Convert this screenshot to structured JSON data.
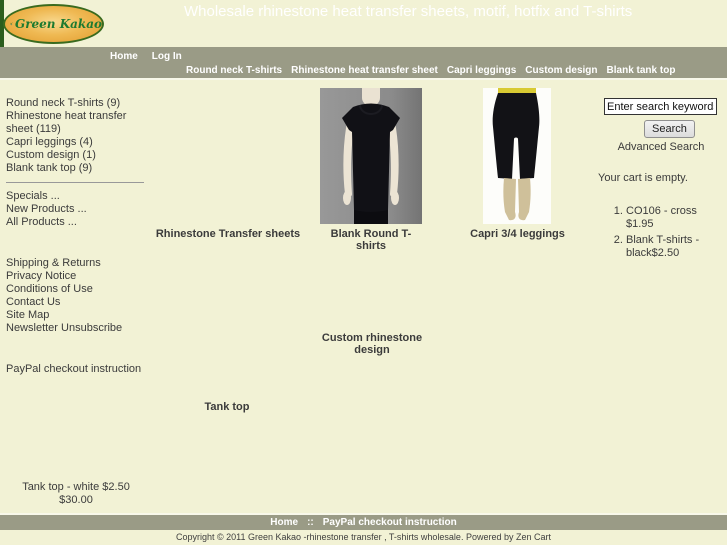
{
  "colors": {
    "page_bg": "#f2f2d5",
    "bar_bg": "#9a9b86",
    "bar_text": "#ffffff",
    "body_text": "#3b3b3b",
    "logo_orange": "#efb953",
    "logo_green": "#1d7a30"
  },
  "header": {
    "logo_text": "Green Kakao",
    "title": "Wholesale rhinestone heat transfer sheets, motif, hotfix and T-shirts"
  },
  "nav": {
    "top_links": [
      "Home",
      "Log In"
    ],
    "category_links": [
      "Round neck T-shirts",
      "Rhinestone heat transfer sheet",
      "Capri leggings",
      "Custom design",
      "Blank tank top"
    ]
  },
  "sidebar": {
    "categories": [
      "Round neck T-shirts (9)",
      "Rhinestone heat transfer sheet (119)",
      "Capri leggings (4)",
      "Custom design (1)",
      "Blank tank top (9)"
    ],
    "browse_links": [
      "Specials ...",
      "New Products ...",
      "All Products ..."
    ],
    "info_links": [
      "Shipping & Returns",
      "Privacy Notice",
      "Conditions of Use",
      "Contact Us",
      "Site Map",
      "Newsletter Unsubscribe"
    ],
    "paypal_link": "PayPal checkout instruction",
    "special": {
      "product": "Tank top - white $2.50",
      "price": "$30.00"
    }
  },
  "main": {
    "category_labels": [
      "Rhinestone Transfer sheets",
      "Blank Round T-shirts",
      "Capri 3/4 leggings",
      "Custom rhinestone design",
      "Tank top"
    ]
  },
  "search": {
    "value": "Enter search keywords he",
    "button_label": "Search",
    "advanced_label": "Advanced Search"
  },
  "cart": {
    "status": "Your cart is empty."
  },
  "popular": {
    "items": [
      "CO106 - cross $1.95",
      "Blank T-shirts - black$2.50"
    ]
  },
  "footer": {
    "links": [
      "Home",
      "PayPal checkout instruction"
    ],
    "separator": "::",
    "copyright": "Copyright © 2011 Green Kakao -rhinestone transfer , T-shirts wholesale. Powered by Zen Cart"
  }
}
